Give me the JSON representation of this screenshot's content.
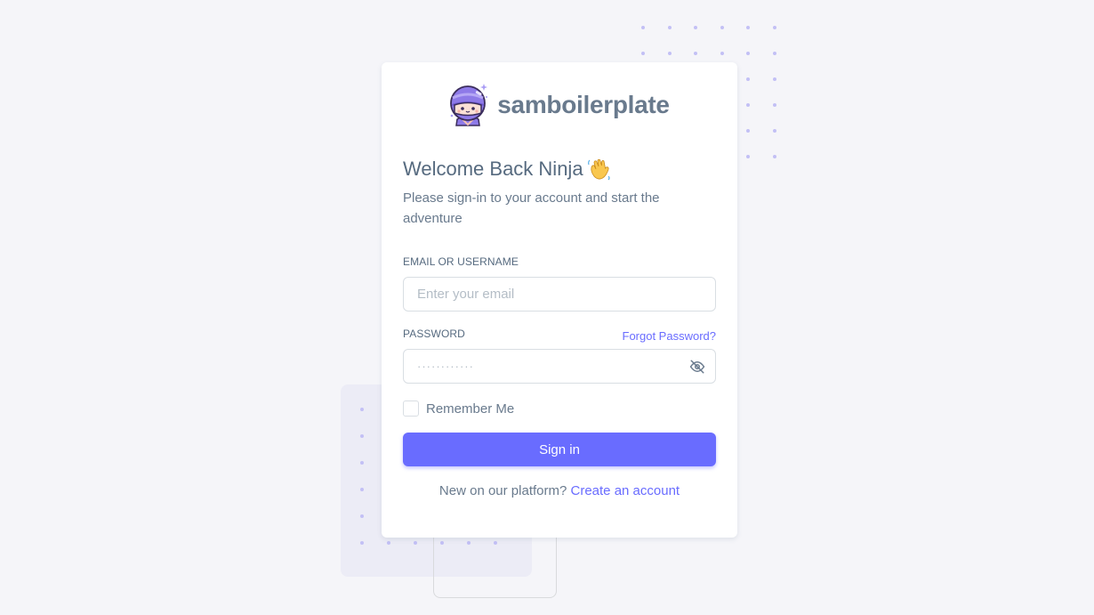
{
  "brand": {
    "name": "samboilerplate",
    "logo_icon": "ninja-mascot-icon"
  },
  "welcome": {
    "title": "Welcome Back Ninja",
    "emoji_icon": "waving-hand-icon",
    "subtitle": "Please sign-in to your account and start the adventure"
  },
  "form": {
    "email_label": "EMAIL OR USERNAME",
    "email_placeholder": "Enter your email",
    "email_value": "",
    "password_label": "PASSWORD",
    "forgot_label": "Forgot Password?",
    "password_placeholder": "············",
    "password_value": "",
    "toggle_icon": "eye-off-icon",
    "remember_label": "Remember Me",
    "remember_checked": false,
    "submit_label": "Sign in"
  },
  "footer": {
    "prompt": "New on our platform?",
    "link_label": "Create an account"
  },
  "colors": {
    "primary": "#696cff",
    "background": "#f5f5f9",
    "heading": "#566a7f",
    "body": "#697a8d"
  }
}
